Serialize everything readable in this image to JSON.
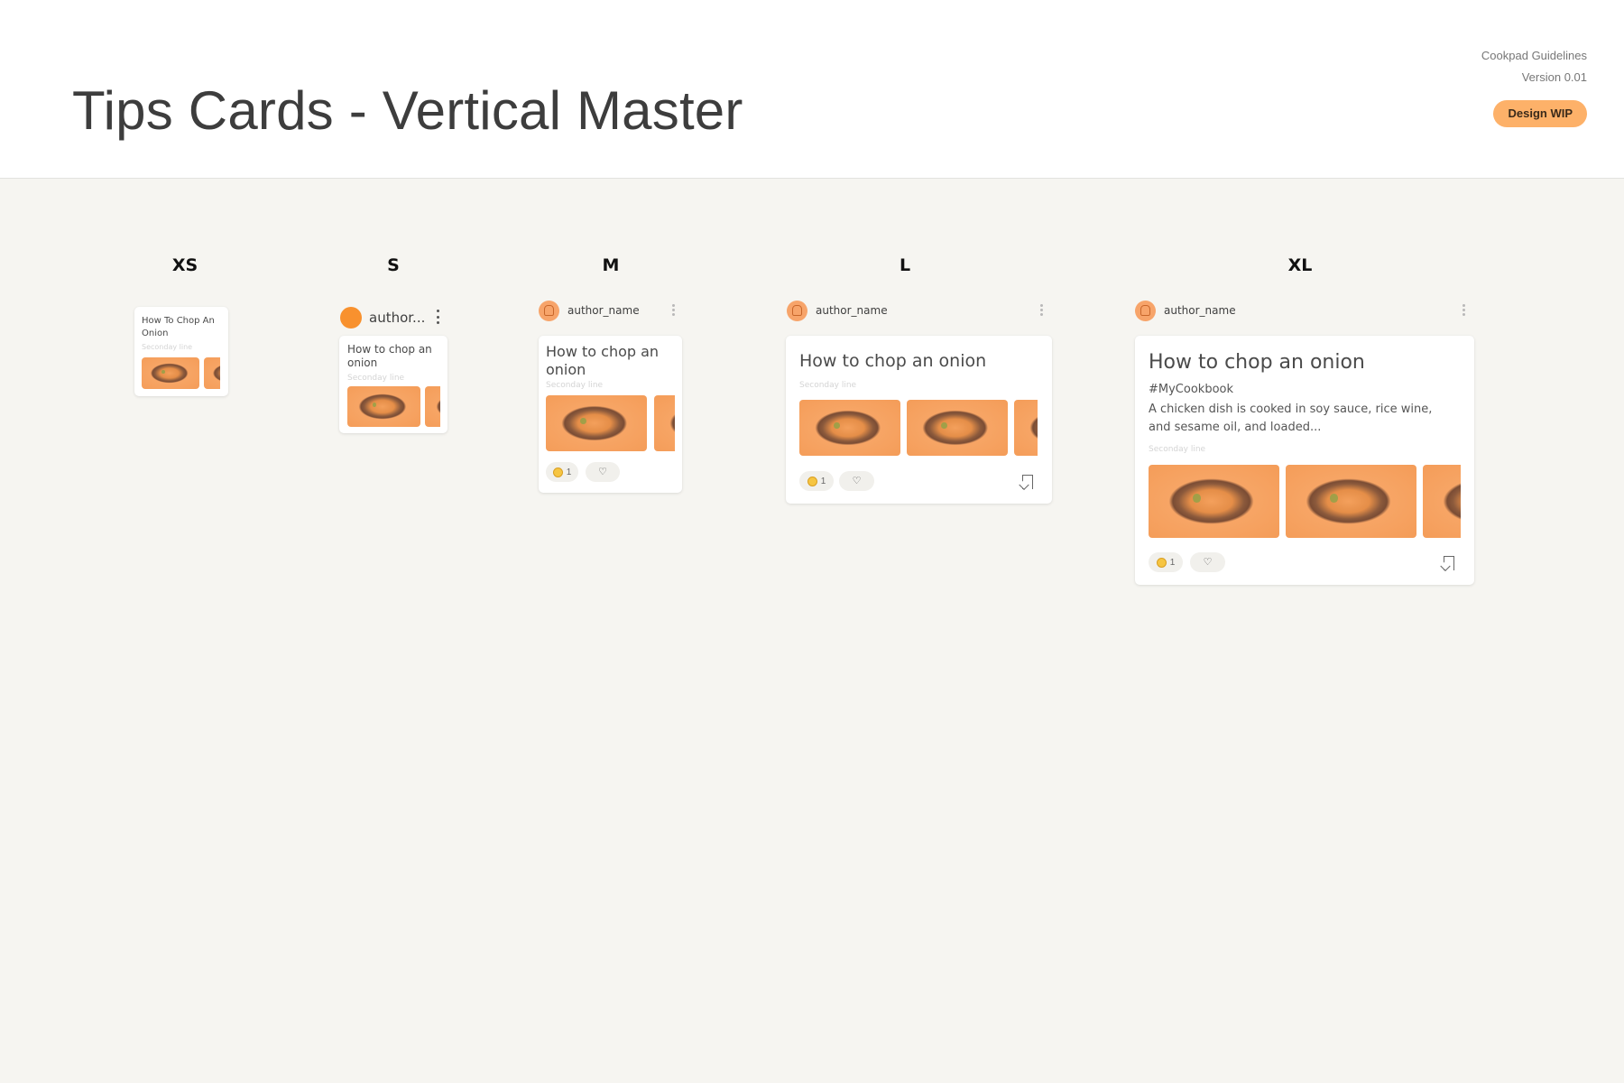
{
  "header": {
    "title": "Tips Cards - Vertical Master",
    "guidelines": "Cookpad Guidelines",
    "version": "Version 0.01",
    "badge": "Design WIP",
    "badge_color": "#fdb169"
  },
  "sizes": {
    "xs": {
      "label": "XS",
      "title": "How To Chop An Onion",
      "secondary": "Seconday line"
    },
    "s": {
      "label": "S",
      "author": "author...",
      "title": "How to chop an onion",
      "secondary": "Seconday line"
    },
    "m": {
      "label": "M",
      "author": "author_name",
      "title": "How to chop an onion",
      "secondary": "Seconday line",
      "reaction_count": "1"
    },
    "l": {
      "label": "L",
      "author": "author_name",
      "title": "How to chop an onion",
      "secondary": "Seconday line",
      "reaction_count": "1"
    },
    "xl": {
      "label": "XL",
      "author": "author_name",
      "title": "How to chop an onion",
      "hashtag": "#MyCookbook",
      "description": "A chicken dish is cooked in soy sauce, rice wine, and sesame oil, and loaded...",
      "secondary": "Seconday line",
      "reaction_count": "1"
    }
  },
  "icons": {
    "avatar": "chef-avatar-icon",
    "more": "more-vertical-icon",
    "reaction": "emoji-reaction-icon",
    "heart": "heart-add-icon",
    "bookmark": "bookmark-icon"
  },
  "colors": {
    "accent": "#f8912e",
    "background": "#f6f5f1",
    "card": "#ffffff"
  }
}
